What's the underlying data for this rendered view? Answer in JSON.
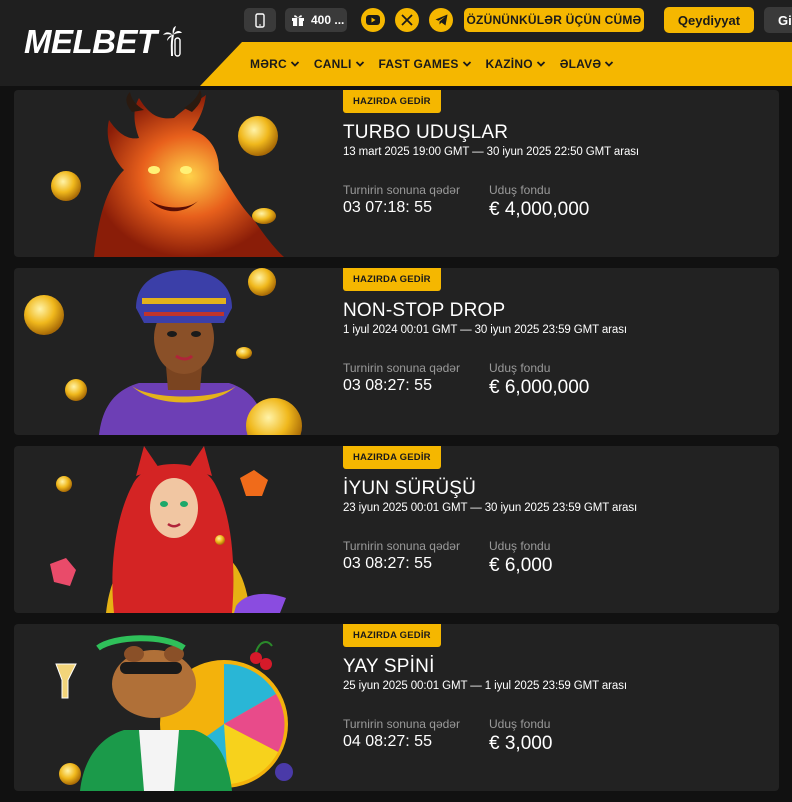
{
  "brand": {
    "logo_text": "MELBET",
    "accent": "#f5b700",
    "header_bg": "#1f1f1f",
    "card_bg": "#222222"
  },
  "topbar": {
    "phone_icon": "mobile-phone-icon",
    "bonus_label": "400 ...",
    "socials": [
      "youtube-icon",
      "x-twitter-icon",
      "telegram-icon"
    ],
    "promo_label": "ÖZÜNÜNKÜLƏR ÜÇÜN CÜMƏ",
    "register_label": "Qeydiyyat",
    "login_label": "Gi"
  },
  "nav": {
    "items": [
      {
        "label": "MƏRC"
      },
      {
        "label": "CANLI"
      },
      {
        "label": "FAST GAMES"
      },
      {
        "label": "KAZİNO"
      },
      {
        "label": "ƏLAVƏ"
      }
    ]
  },
  "tournaments": [
    {
      "status": "HAZIRDA GEDİR",
      "title": "TURBO UDUŞLAR",
      "dates": "13 mart 2025 19:00 GMT — 30 iyun 2025 22:50 GMT arası",
      "time_label": "Turnirin sonuna qədər",
      "time_left": "03 07:18: 55",
      "prize_label": "Uduş fondu",
      "prize": "€ 4,000,000",
      "art": "fire-dragon-illustration"
    },
    {
      "status": "HAZIRDA GEDİR",
      "title": "NON-STOP DROP",
      "dates": "1 iyul 2024 00:01 GMT — 30 iyun 2025 23:59 GMT arası",
      "time_label": "Turnirin sonuna qədər",
      "time_left": "03 08:27: 55",
      "prize_label": "Uduş fondu",
      "prize": "€ 6,000,000",
      "art": "egyptian-queen-illustration"
    },
    {
      "status": "HAZIRDA GEDİR",
      "title": "İYUN SÜRÜŞÜ",
      "dates": "23 iyun 2025 00:01 GMT — 30 iyun 2025 23:59 GMT arası",
      "time_label": "Turnirin sonuna qədər",
      "time_left": "03 08:27: 55",
      "prize_label": "Uduş fondu",
      "prize": "€ 6,000",
      "art": "fox-girl-illustration"
    },
    {
      "status": "HAZIRDA GEDİR",
      "title": "YAY SPİNİ",
      "dates": "25 iyun 2025 00:01 GMT — 1 iyul 2025 23:59 GMT arası",
      "time_label": "Turnirin sonuna qədər",
      "time_left": "04 08:27: 55",
      "prize_label": "Uduş fondu",
      "prize": "€ 3,000",
      "art": "capybara-wheel-illustration"
    }
  ]
}
